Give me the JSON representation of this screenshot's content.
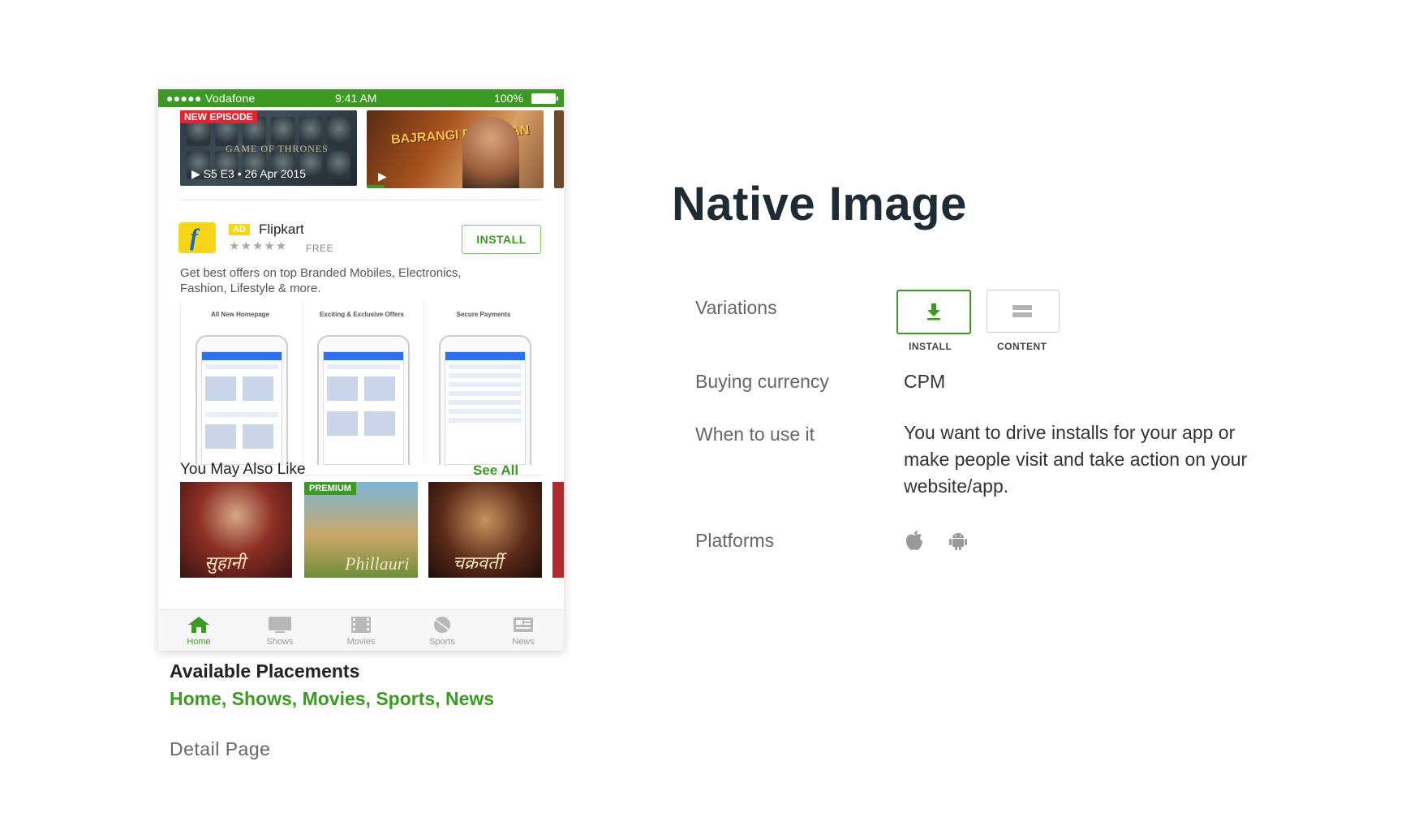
{
  "phone": {
    "status": {
      "carrier": "●●●●● Vodafone",
      "time": "9:41 AM",
      "battery": "100%"
    },
    "hero": [
      {
        "badge": "NEW EPISODE",
        "caption": "S5 E3 • 26 Apr 2015"
      },
      {
        "caption": ""
      }
    ],
    "ad": {
      "badge": "AD",
      "name": "Flipkart",
      "rating_stars": "★★★★★",
      "price": "FREE",
      "install_label": "INSTALL",
      "description": "Get best offers on top Branded Mobiles, Electronics, Fashion, Lifestyle & more.",
      "screenshots": [
        "All New Homepage",
        "Exciting & Exclusive Offers",
        "Secure Payments"
      ]
    },
    "recommend": {
      "title": "You May Also Like",
      "see_all": "See All",
      "premium_badge": "PREMIUM"
    },
    "tabs": [
      {
        "label": "Home",
        "icon": "home-icon",
        "active": true
      },
      {
        "label": "Shows",
        "icon": "tv-icon",
        "active": false
      },
      {
        "label": "Movies",
        "icon": "film-icon",
        "active": false
      },
      {
        "label": "Sports",
        "icon": "ball-icon",
        "active": false
      },
      {
        "label": "News",
        "icon": "newspaper-icon",
        "active": false
      }
    ]
  },
  "placements": {
    "title": "Available Placements",
    "list": "Home, Shows, Movies, Sports, News",
    "detail": "Detail Page"
  },
  "info": {
    "title": "Native Image",
    "variations_label": "Variations",
    "variations": [
      {
        "label": "INSTALL",
        "icon": "download-icon",
        "selected": true
      },
      {
        "label": "CONTENT",
        "icon": "content-icon",
        "selected": false
      }
    ],
    "currency_label": "Buying currency",
    "currency_value": "CPM",
    "when_label": "When to use it",
    "when_value": "You want to drive installs for your app or make people visit and take action on your website/app.",
    "platforms_label": "Platforms",
    "platforms": [
      "apple-icon",
      "android-icon"
    ]
  },
  "colors": {
    "accent": "#3c9a24",
    "title": "#1f2b33",
    "ad_yellow": "#f7d619",
    "badge_red": "#e8232f"
  }
}
